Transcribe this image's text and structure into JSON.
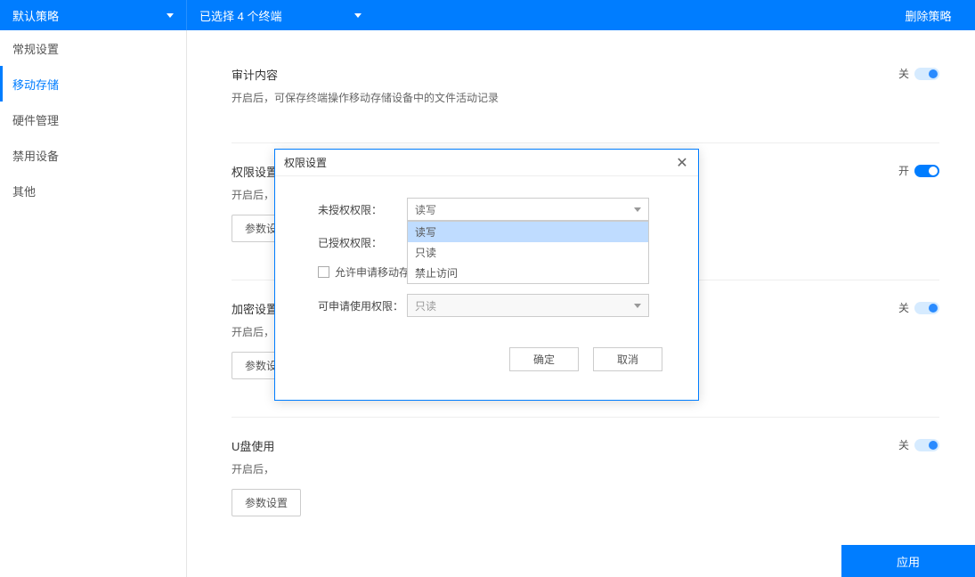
{
  "header": {
    "policy_dropdown": "默认策略",
    "terminal_dropdown": "已选择 4 个终端",
    "delete_action": "删除策略"
  },
  "sidebar": {
    "items": [
      {
        "label": "常规设置"
      },
      {
        "label": "移动存储"
      },
      {
        "label": "硬件管理"
      },
      {
        "label": "禁用设备"
      },
      {
        "label": "其他"
      }
    ]
  },
  "sections": [
    {
      "title": "审计内容",
      "desc": "开启后，可保存终端操作移动存储设备中的文件活动记录",
      "toggle_text": "关",
      "toggle_on": false,
      "has_param": false
    },
    {
      "title": "权限设置",
      "desc": "开启后，",
      "toggle_text": "开",
      "toggle_on": true,
      "has_param": true,
      "param_label": "参数设"
    },
    {
      "title": "加密设置",
      "desc": "开启后，",
      "toggle_text": "关",
      "toggle_on": false,
      "has_param": true,
      "param_label": "参数设"
    },
    {
      "title": "U盘使用",
      "desc": "开启后，",
      "toggle_text": "关",
      "toggle_on": false,
      "has_param": true,
      "param_label": "参数设置"
    }
  ],
  "footer": {
    "apply_label": "应用"
  },
  "modal": {
    "title": "权限设置",
    "row1_label": "未授权权限：",
    "row1_value": "读写",
    "row2_label": "已授权权限：",
    "dropdown_options": [
      "读写",
      "只读",
      "禁止访问"
    ],
    "checkbox_label": "允许申请移动存储使用审批",
    "row3_label": "可申请使用权限：",
    "row3_value": "只读",
    "ok_label": "确定",
    "cancel_label": "取消"
  }
}
